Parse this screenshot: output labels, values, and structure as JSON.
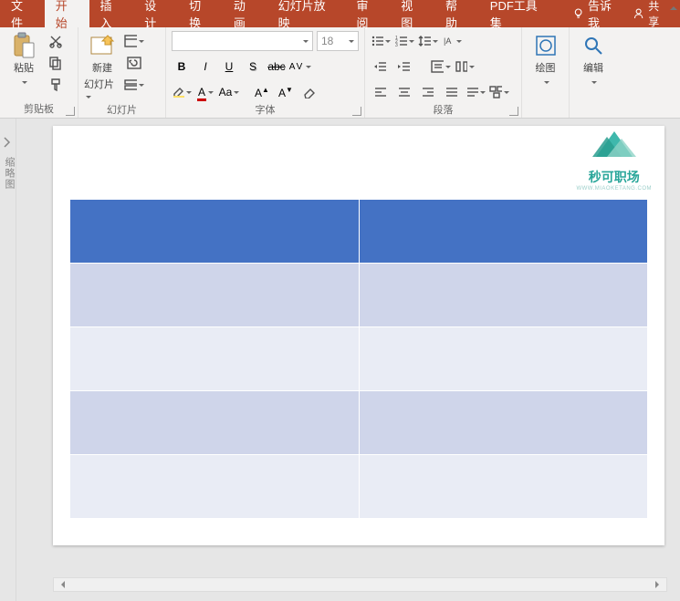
{
  "tabs": {
    "file": "文件",
    "home": "开始",
    "insert": "插入",
    "design": "设计",
    "transitions": "切换",
    "animations": "动画",
    "slideshow": "幻灯片放映",
    "review": "审阅",
    "view": "视图",
    "help": "帮助",
    "pdf": "PDF工具集",
    "tellme": "告诉我",
    "share": "共享"
  },
  "groups": {
    "clipboard": "剪贴板",
    "slides": "幻灯片",
    "font": "字体",
    "paragraph": "段落",
    "drawing": "绘图",
    "editing": "编辑"
  },
  "buttons": {
    "paste": "粘贴",
    "new_slide_l1": "新建",
    "new_slide_l2": "幻灯片",
    "draw": "绘图",
    "edit": "编辑"
  },
  "font_box": {
    "name_placeholder": "",
    "size": "18"
  },
  "outline": "缩略图",
  "logo": {
    "brand": "秒可职场",
    "sub": "WWW.MIAOKETANG.COM"
  },
  "chart_data": {
    "type": "table",
    "columns": 2,
    "rows": 5,
    "header_row": true,
    "cells": [
      [
        "",
        ""
      ],
      [
        "",
        ""
      ],
      [
        "",
        ""
      ],
      [
        "",
        ""
      ],
      [
        "",
        ""
      ]
    ],
    "style": {
      "header_fill": "#4472c4",
      "band1_fill": "#cfd5ea",
      "band2_fill": "#e9ecf5"
    }
  }
}
